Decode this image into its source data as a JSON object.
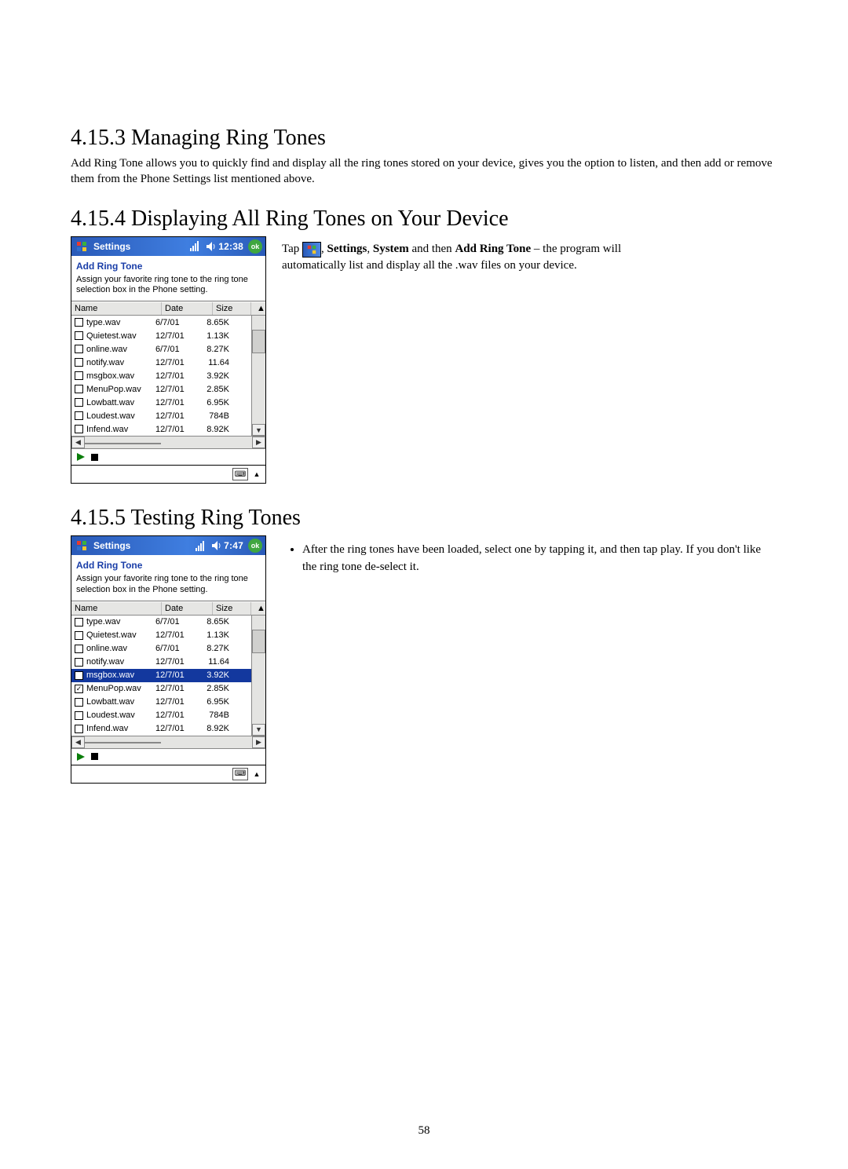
{
  "page_number": "58",
  "s1": {
    "heading": "4.15.3 Managing Ring Tones",
    "para": "Add Ring Tone allows you to quickly find and display all the ring tones stored on your device, gives you the option to listen, and then add or remove them from the Phone Settings list mentioned above."
  },
  "s2": {
    "heading": "4.15.4 Displaying All Ring Tones on Your Device",
    "text_prefix": "Tap ",
    "text_after_icon": ", ",
    "settings_word": "Settings",
    "sep1": ", ",
    "system_word": "System",
    "mid": " and then ",
    "add_ring_tone_word": "Add Ring Tone",
    "tail": " – the program will",
    "line2": "automatically list and display all the .wav files on your device."
  },
  "s3": {
    "heading": "4.15.5 Testing Ring Tones",
    "bullet": "After the ring tones have been loaded, select one by tapping it, and then tap play. If you don't like the ring tone de-select it."
  },
  "ppc1": {
    "title": "Settings",
    "time": "12:38",
    "ok": "ok",
    "subhead": "Add Ring Tone",
    "instr": "Assign your favorite ring tone to the ring tone selection box in the Phone setting.",
    "headers": {
      "name": "Name",
      "date": "Date",
      "size": "Size"
    },
    "files": [
      {
        "name": "type.wav",
        "date": "6/7/01",
        "size": "8.65K",
        "checked": false,
        "selected": false
      },
      {
        "name": "Quietest.wav",
        "date": "12/7/01",
        "size": "1.13K",
        "checked": false,
        "selected": false
      },
      {
        "name": "online.wav",
        "date": "6/7/01",
        "size": "8.27K",
        "checked": false,
        "selected": false
      },
      {
        "name": "notify.wav",
        "date": "12/7/01",
        "size": "11.64",
        "checked": false,
        "selected": false
      },
      {
        "name": "msgbox.wav",
        "date": "12/7/01",
        "size": "3.92K",
        "checked": false,
        "selected": false
      },
      {
        "name": "MenuPop.wav",
        "date": "12/7/01",
        "size": "2.85K",
        "checked": false,
        "selected": false
      },
      {
        "name": "Lowbatt.wav",
        "date": "12/7/01",
        "size": "6.95K",
        "checked": false,
        "selected": false
      },
      {
        "name": "Loudest.wav",
        "date": "12/7/01",
        "size": "784B",
        "checked": false,
        "selected": false
      },
      {
        "name": "Infend.wav",
        "date": "12/7/01",
        "size": "8.92K",
        "checked": false,
        "selected": false
      }
    ]
  },
  "ppc2": {
    "title": "Settings",
    "time": "7:47",
    "ok": "ok",
    "subhead": "Add Ring Tone",
    "instr": "Assign your favorite ring tone to the ring tone selection box in the Phone setting.",
    "headers": {
      "name": "Name",
      "date": "Date",
      "size": "Size"
    },
    "files": [
      {
        "name": "type.wav",
        "date": "6/7/01",
        "size": "8.65K",
        "checked": false,
        "selected": false
      },
      {
        "name": "Quietest.wav",
        "date": "12/7/01",
        "size": "1.13K",
        "checked": false,
        "selected": false
      },
      {
        "name": "online.wav",
        "date": "6/7/01",
        "size": "8.27K",
        "checked": false,
        "selected": false
      },
      {
        "name": "notify.wav",
        "date": "12/7/01",
        "size": "11.64",
        "checked": false,
        "selected": false
      },
      {
        "name": "msgbox.wav",
        "date": "12/7/01",
        "size": "3.92K",
        "checked": false,
        "selected": true
      },
      {
        "name": "MenuPop.wav",
        "date": "12/7/01",
        "size": "2.85K",
        "checked": true,
        "selected": false
      },
      {
        "name": "Lowbatt.wav",
        "date": "12/7/01",
        "size": "6.95K",
        "checked": false,
        "selected": false
      },
      {
        "name": "Loudest.wav",
        "date": "12/7/01",
        "size": "784B",
        "checked": false,
        "selected": false
      },
      {
        "name": "Infend.wav",
        "date": "12/7/01",
        "size": "8.92K",
        "checked": false,
        "selected": false
      }
    ]
  }
}
